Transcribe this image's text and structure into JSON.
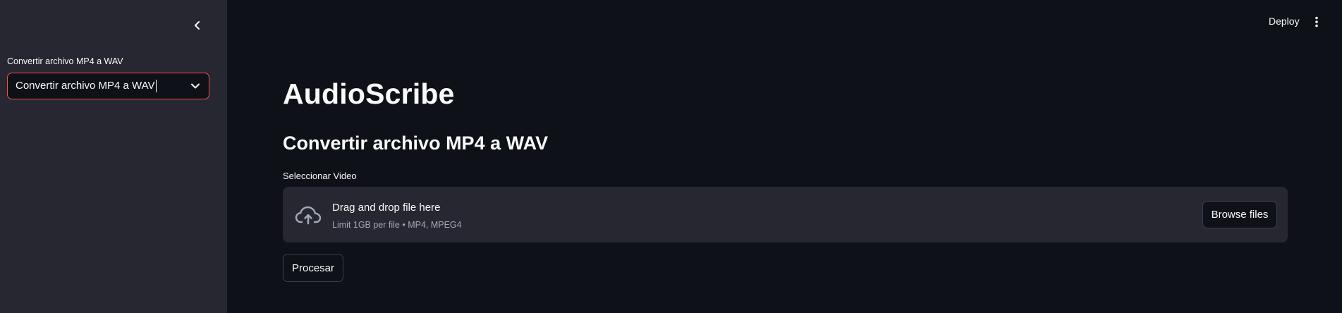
{
  "sidebar": {
    "collapse_icon": "chevron-left-icon",
    "select_label": "Convertir archivo MP4 a WAV",
    "select_value": "Convertir archivo MP4 a WAV",
    "select_icon": "chevron-down-icon",
    "accent_color": "#ff4b4b",
    "background": "#262730"
  },
  "header": {
    "deploy_label": "Deploy",
    "menu_icon": "vertical-dots-icon"
  },
  "main": {
    "title": "AudioScribe",
    "subtitle": "Convertir archivo MP4 a WAV",
    "uploader": {
      "label": "Seleccionar Video",
      "icon": "cloud-upload-icon",
      "drop_text": "Drag and drop file here",
      "limit_text": "Limit 1GB per file • MP4, MPEG4",
      "browse_label": "Browse files"
    },
    "process_label": "Procesar",
    "background": "#0e1117"
  }
}
